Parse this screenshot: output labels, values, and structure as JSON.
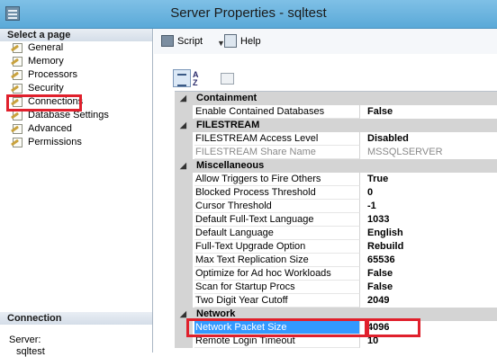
{
  "window": {
    "title": "Server Properties - sqltest"
  },
  "left_pane": {
    "header": "Select a page",
    "pages": [
      {
        "label": "General"
      },
      {
        "label": "Memory"
      },
      {
        "label": "Processors"
      },
      {
        "label": "Security"
      },
      {
        "label": "Connections"
      },
      {
        "label": "Database Settings"
      },
      {
        "label": "Advanced"
      },
      {
        "label": "Permissions"
      }
    ],
    "selected_page": "Advanced",
    "connection": {
      "header": "Connection",
      "server_label": "Server:",
      "server_value": "sqltest"
    }
  },
  "toolbar": {
    "script_label": "Script",
    "help_label": "Help"
  },
  "property_grid": {
    "rows": [
      {
        "kind": "category",
        "name": "Containment"
      },
      {
        "kind": "property",
        "name": "Enable Contained Databases",
        "value": "False"
      },
      {
        "kind": "category",
        "name": "FILESTREAM"
      },
      {
        "kind": "property",
        "name": "FILESTREAM Access Level",
        "value": "Disabled"
      },
      {
        "kind": "property",
        "name": "FILESTREAM Share Name",
        "value": "MSSQLSERVER",
        "disabled": true
      },
      {
        "kind": "category",
        "name": "Miscellaneous"
      },
      {
        "kind": "property",
        "name": "Allow Triggers to Fire Others",
        "value": "True"
      },
      {
        "kind": "property",
        "name": "Blocked Process Threshold",
        "value": "0"
      },
      {
        "kind": "property",
        "name": "Cursor Threshold",
        "value": "-1"
      },
      {
        "kind": "property",
        "name": "Default Full-Text Language",
        "value": "1033"
      },
      {
        "kind": "property",
        "name": "Default Language",
        "value": "English"
      },
      {
        "kind": "property",
        "name": "Full-Text Upgrade Option",
        "value": "Rebuild"
      },
      {
        "kind": "property",
        "name": "Max Text Replication Size",
        "value": "65536"
      },
      {
        "kind": "property",
        "name": "Optimize for Ad hoc Workloads",
        "value": "False"
      },
      {
        "kind": "property",
        "name": "Scan for Startup Procs",
        "value": "False"
      },
      {
        "kind": "property",
        "name": "Two Digit Year Cutoff",
        "value": "2049"
      },
      {
        "kind": "category",
        "name": "Network"
      },
      {
        "kind": "property",
        "name": "Network Packet Size",
        "value": "4096",
        "selected": true
      },
      {
        "kind": "property",
        "name": "Remote Login Timeout",
        "value": "10"
      }
    ]
  },
  "colors": {
    "highlight": "#e0202c",
    "selection": "#3399ff",
    "category_bg": "#d4d4d4"
  }
}
